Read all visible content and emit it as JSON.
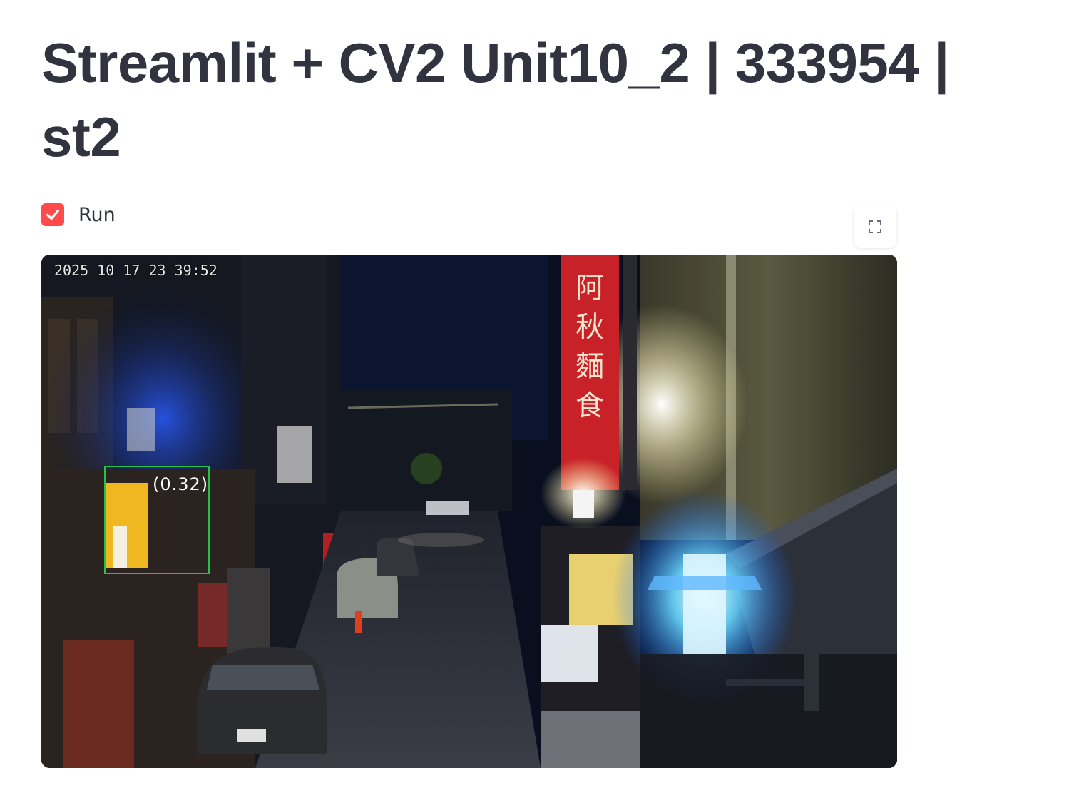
{
  "header": {
    "title": "Streamlit + CV2 Unit10_2 | 333954 | st2"
  },
  "controls": {
    "run_label": "Run",
    "run_checked": true
  },
  "video": {
    "timestamp": "2025 10 17 23 39:52",
    "detection_label": "(0.32)"
  },
  "colors": {
    "accent": "#ff4b4b",
    "text": "#31333f",
    "detection_box": "#26c24a"
  },
  "icons": {
    "checkbox": "checkmark-icon",
    "fullscreen": "fullscreen-icon"
  }
}
